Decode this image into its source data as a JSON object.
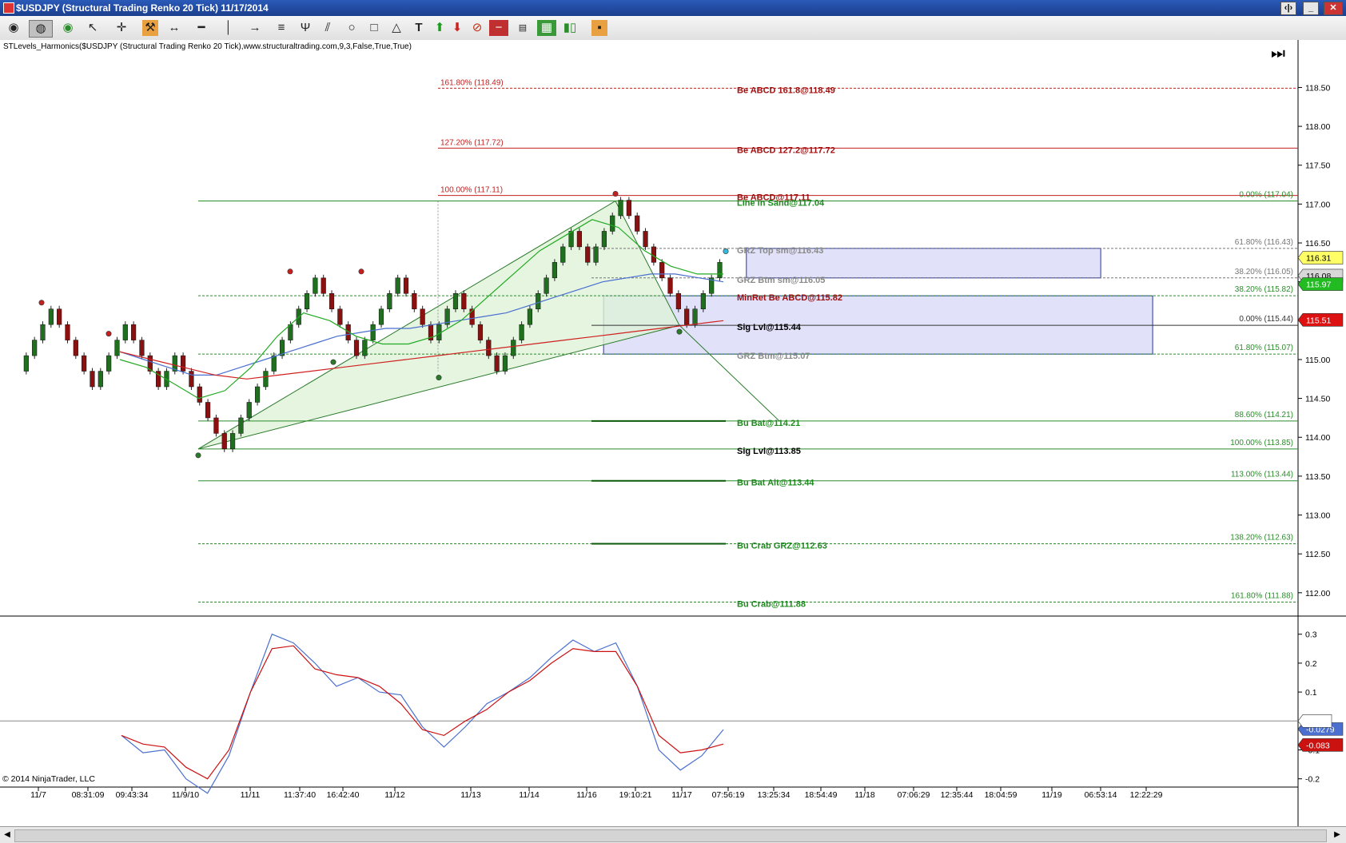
{
  "window": {
    "title": "$USDJPY (Structural Trading Renko 20 Tick)  11/17/2014"
  },
  "toolbar": {
    "icons": [
      "eye-icon",
      "palette-icon",
      "eye-green-icon",
      "cursor-icon",
      "crosshair-icon",
      "hammer-icon",
      "arrow-line-icon",
      "line-icon",
      "vertical-line-icon",
      "ray-icon",
      "fib-icon",
      "pitchfork-icon",
      "trend-channel-icon",
      "circle-icon",
      "rectangle-icon",
      "triangle-icon",
      "text-icon",
      "arrow-up-icon",
      "arrow-down-icon",
      "no-draw-icon",
      "minus-icon",
      "data-box-icon",
      "layout-icon",
      "bar-type-icon",
      "properties-icon"
    ]
  },
  "colors": {
    "up": "#1f6f1f",
    "down": "#8b1010",
    "zone": "#dcdcf8",
    "zoneBorder": "#2233aa",
    "fibRed": "#c42020",
    "fibGreen": "#2a8c2a",
    "axis": "#000000"
  },
  "chart_data": {
    "type": "candlestick",
    "indicator": "STLevels_Harmonics($USDJPY (Structural Trading Renko 20 Tick),www.structuraltrading.com,9,3,False,True,True)",
    "price_axis": {
      "ylim": [
        111.7,
        118.7
      ],
      "ticks": [
        "118.50",
        "118.00",
        "117.50",
        "117.00",
        "116.50",
        "116.00",
        "115.50",
        "115.00",
        "114.50",
        "114.00",
        "113.50",
        "113.00",
        "112.50",
        "112.00"
      ]
    },
    "osc_axis": {
      "ylim": [
        -0.27,
        0.36
      ],
      "ticks": [
        "0.3",
        "0.2",
        "0.1",
        "0",
        "-0.1",
        "-0.2"
      ]
    },
    "time_labels": [
      "11/7",
      "08:31:09",
      "09:43:34",
      "11/9/10",
      "11/11",
      "11:37:40",
      "16:42:40",
      "11/12",
      "11/13",
      "11/14",
      "11/16",
      "19:10:21",
      "11/17",
      "07:56:19",
      "13:25:34",
      "18:54:49",
      "11/18",
      "07:06:29",
      "12:35:44",
      "18:04:59",
      "11/19",
      "06:53:14",
      "12:22:29"
    ],
    "price_labels": [
      {
        "text": "116.31",
        "value": 116.31,
        "bg": "#ffff66"
      },
      {
        "text": "116.08",
        "value": 116.08,
        "bg": "#d8d8d8"
      },
      {
        "text": "115.97",
        "value": 115.97,
        "bg": "#22bb22"
      },
      {
        "text": "115.51",
        "value": 115.51,
        "bg": "#dd1111"
      }
    ],
    "osc_labels": [
      {
        "text": "-0.0279",
        "value": -0.0279,
        "bg": "#4a6fcf"
      },
      {
        "text": "-0.083",
        "value": -0.083,
        "bg": "#cc1111"
      }
    ],
    "left_fibs": [
      {
        "text": "161.80% (118.49)",
        "value": 118.49
      },
      {
        "text": "127.20% (117.72)",
        "value": 117.72
      },
      {
        "text": "100.00% (117.11)",
        "value": 117.11
      }
    ],
    "right_fibs": [
      {
        "text": "0.00% (117.04)",
        "value": 117.04
      },
      {
        "text": "61.80% (116.43)",
        "value": 116.43
      },
      {
        "text": "38.20% (116.05)",
        "value": 116.05
      },
      {
        "text": "38.20% (115.82)",
        "value": 115.82
      },
      {
        "text": "0.00% (115.44)",
        "value": 115.44
      },
      {
        "text": "61.80% (115.07)",
        "value": 115.07
      },
      {
        "text": "88.60% (114.21)",
        "value": 114.21
      },
      {
        "text": "100.00% (113.85)",
        "value": 113.85
      },
      {
        "text": "113.00% (113.44)",
        "value": 113.44
      },
      {
        "text": "138.20% (112.63)",
        "value": 112.63
      },
      {
        "text": "161.80% (111.88)",
        "value": 111.88
      }
    ],
    "level_labels": [
      {
        "text": "Be ABCD 161.8@118.49",
        "value": 118.49,
        "color": "#a01010"
      },
      {
        "text": "Be ABCD 127.2@117.72",
        "value": 117.72,
        "color": "#a01010"
      },
      {
        "text": "Be ABCD@117.11",
        "value": 117.11,
        "color": "#a01010"
      },
      {
        "text": "Line in Sand@117.04",
        "value": 117.04,
        "color": "#1f8a1f"
      },
      {
        "text": "GRZ Top sm@116.43",
        "value": 116.43,
        "color": "#8a8a8a"
      },
      {
        "text": "GRZ Btm sm@116.05",
        "value": 116.05,
        "color": "#8a8a8a"
      },
      {
        "text": "MinRet Be ABCD@115.82",
        "value": 115.82,
        "color": "#a01010"
      },
      {
        "text": "Sig Lvl@115.44",
        "value": 115.44,
        "color": "#000000"
      },
      {
        "text": "GRZ Btm@115.07",
        "value": 115.07,
        "color": "#8a8a8a"
      },
      {
        "text": "Bu Bat@114.21",
        "value": 114.21,
        "color": "#1f8a1f"
      },
      {
        "text": "Sig Lvl@113.85",
        "value": 113.85,
        "color": "#000000"
      },
      {
        "text": "Bu Bat Alt@113.44",
        "value": 113.44,
        "color": "#1f8a1f"
      },
      {
        "text": "Bu Crab GRZ@112.63",
        "value": 112.63,
        "color": "#1f8a1f"
      },
      {
        "text": "Bu Crab@111.88",
        "value": 111.88,
        "color": "#1f8a1f"
      }
    ],
    "zones": [
      {
        "x0": 0.575,
        "x1": 0.848,
        "y0": 116.43,
        "y1": 116.05
      },
      {
        "x0": 0.465,
        "x1": 0.888,
        "y0": 115.82,
        "y1": 115.07
      }
    ],
    "bricks": [
      115.05,
      115.25,
      115.45,
      115.65,
      115.45,
      115.25,
      115.05,
      114.85,
      114.65,
      114.85,
      115.05,
      115.25,
      115.45,
      115.25,
      115.05,
      114.85,
      114.65,
      114.85,
      115.05,
      114.85,
      114.65,
      114.45,
      114.25,
      114.05,
      113.85,
      114.05,
      114.25,
      114.45,
      114.65,
      114.85,
      115.05,
      115.25,
      115.45,
      115.65,
      115.85,
      116.05,
      115.85,
      115.65,
      115.45,
      115.25,
      115.05,
      115.25,
      115.45,
      115.65,
      115.85,
      116.05,
      115.85,
      115.65,
      115.45,
      115.25,
      115.45,
      115.65,
      115.85,
      115.65,
      115.45,
      115.25,
      115.05,
      114.85,
      115.05,
      115.25,
      115.45,
      115.65,
      115.85,
      116.05,
      116.25,
      116.45,
      116.65,
      116.45,
      116.25,
      116.45,
      116.65,
      116.85,
      117.05,
      116.85,
      116.65,
      116.45,
      116.25,
      116.05,
      115.85,
      115.65,
      115.45,
      115.65,
      115.85,
      116.05,
      116.25
    ],
    "ema_blue": [
      115.1,
      115.0,
      114.9,
      114.8,
      114.8,
      114.9,
      115.0,
      115.1,
      115.2,
      115.3,
      115.35,
      115.4,
      115.4,
      115.45,
      115.5,
      115.55,
      115.6,
      115.7,
      115.8,
      115.9,
      116.0,
      116.05,
      116.1,
      116.1,
      116.05,
      116.0
    ],
    "ema_red": [
      115.1,
      115.0,
      114.9,
      114.8,
      114.75,
      114.8,
      114.85,
      114.9,
      114.95,
      115.0,
      115.05,
      115.1,
      115.15,
      115.2,
      115.25,
      115.3,
      115.35,
      115.4,
      115.45,
      115.5
    ],
    "ema_green": [
      115.0,
      114.9,
      114.7,
      114.5,
      114.6,
      114.9,
      115.3,
      115.6,
      115.5,
      115.3,
      115.2,
      115.2,
      115.3,
      115.5,
      115.8,
      116.1,
      116.4,
      116.6,
      116.8,
      116.7,
      116.4,
      116.2,
      116.1,
      116.1
    ],
    "osc_blue": [
      -0.05,
      -0.11,
      -0.1,
      -0.2,
      -0.25,
      -0.12,
      0.1,
      0.3,
      0.27,
      0.2,
      0.12,
      0.15,
      0.1,
      0.09,
      -0.02,
      -0.09,
      -0.02,
      0.06,
      0.1,
      0.15,
      0.22,
      0.28,
      0.24,
      0.27,
      0.12,
      -0.1,
      -0.17,
      -0.12,
      -0.03
    ],
    "osc_red": [
      -0.05,
      -0.08,
      -0.09,
      -0.16,
      -0.2,
      -0.1,
      0.1,
      0.25,
      0.26,
      0.18,
      0.16,
      0.15,
      0.12,
      0.06,
      -0.03,
      -0.05,
      0.0,
      0.04,
      0.1,
      0.14,
      0.2,
      0.25,
      0.24,
      0.24,
      0.12,
      -0.05,
      -0.11,
      -0.1,
      -0.08
    ]
  },
  "footer": {
    "copyright": "© 2014 NinjaTrader, LLC"
  }
}
